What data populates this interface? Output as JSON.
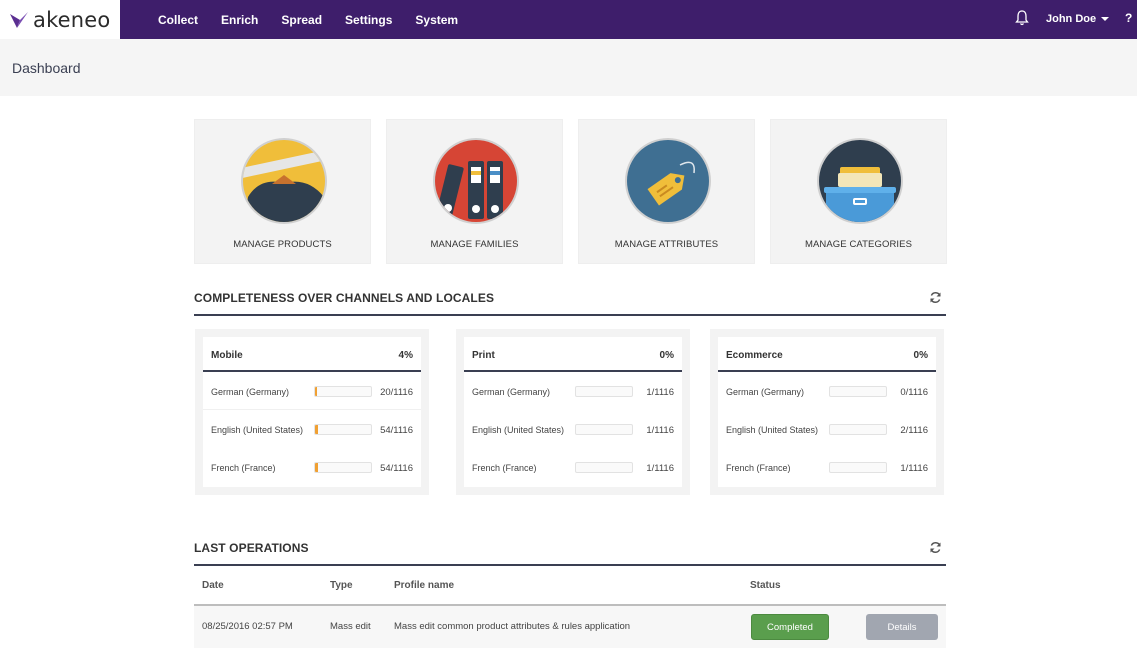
{
  "brand": {
    "name": "akeneo",
    "color": "#3e1e6b"
  },
  "nav": {
    "items": [
      "Collect",
      "Enrich",
      "Spread",
      "Settings",
      "System"
    ]
  },
  "user": {
    "name": "John Doe",
    "help": "?"
  },
  "page": {
    "title": "Dashboard"
  },
  "tiles": [
    {
      "label": "MANAGE PRODUCTS",
      "icon": "products-icon"
    },
    {
      "label": "MANAGE FAMILIES",
      "icon": "families-icon"
    },
    {
      "label": "MANAGE ATTRIBUTES",
      "icon": "attributes-icon"
    },
    {
      "label": "MANAGE CATEGORIES",
      "icon": "categories-icon"
    }
  ],
  "completeness": {
    "title": "COMPLETENESS OVER CHANNELS AND LOCALES",
    "channels": [
      {
        "name": "Mobile",
        "pct": "4%",
        "locales": [
          {
            "name": "German (Germany)",
            "count": "20/1116",
            "progress": 0.018
          },
          {
            "name": "English (United States)",
            "count": "54/1116",
            "progress": 0.048
          },
          {
            "name": "French (France)",
            "count": "54/1116",
            "progress": 0.048
          }
        ]
      },
      {
        "name": "Print",
        "pct": "0%",
        "locales": [
          {
            "name": "German (Germany)",
            "count": "1/1116",
            "progress": 0.0
          },
          {
            "name": "English (United States)",
            "count": "1/1116",
            "progress": 0.0
          },
          {
            "name": "French (France)",
            "count": "1/1116",
            "progress": 0.0
          }
        ]
      },
      {
        "name": "Ecommerce",
        "pct": "0%",
        "locales": [
          {
            "name": "German (Germany)",
            "count": "0/1116",
            "progress": 0.0
          },
          {
            "name": "English (United States)",
            "count": "2/1116",
            "progress": 0.0
          },
          {
            "name": "French (France)",
            "count": "1/1116",
            "progress": 0.0
          }
        ]
      }
    ]
  },
  "operations": {
    "title": "LAST OPERATIONS",
    "headers": {
      "date": "Date",
      "type": "Type",
      "profile": "Profile name",
      "status": "Status"
    },
    "rows": [
      {
        "date": "08/25/2016 02:57 PM",
        "type": "Mass edit",
        "profile": "Mass edit common product attributes & rules application",
        "status": "Completed",
        "action": "Details"
      }
    ]
  },
  "colors": {
    "progress": "#f0a032",
    "completed": "#5a9e4d",
    "details": "#a1a6b0",
    "section_line": "#3a3f52"
  }
}
